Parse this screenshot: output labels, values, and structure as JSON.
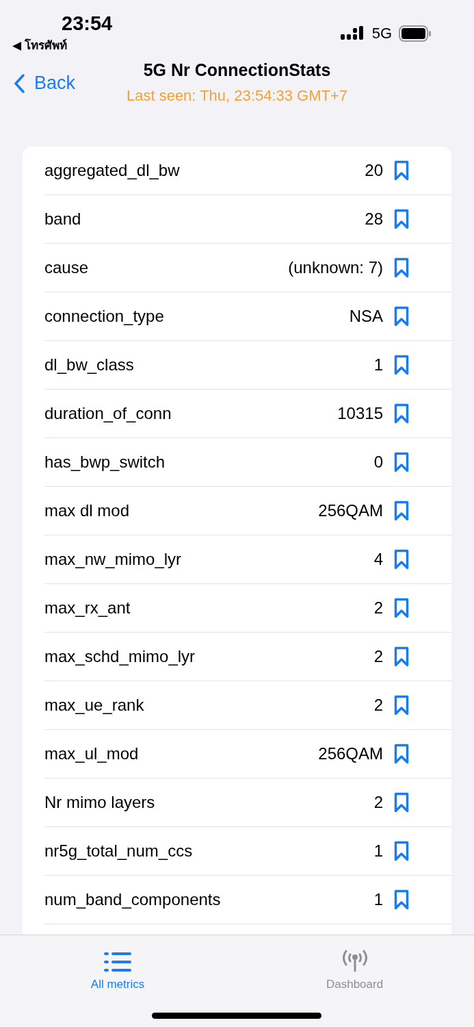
{
  "status_bar": {
    "time": "23:54",
    "back_app": "◀ โทรศัพท์",
    "network": "5G"
  },
  "nav": {
    "back": "Back",
    "title": "5G Nr ConnectionStats",
    "subtitle": "Last seen: Thu, 23:54:33 GMT+7"
  },
  "metrics": [
    {
      "name": "aggregated_dl_bw",
      "value": "20"
    },
    {
      "name": "band",
      "value": "28"
    },
    {
      "name": "cause",
      "value": "(unknown: 7)"
    },
    {
      "name": "connection_type",
      "value": "NSA"
    },
    {
      "name": "dl_bw_class",
      "value": "1"
    },
    {
      "name": "duration_of_conn",
      "value": "10315"
    },
    {
      "name": "has_bwp_switch",
      "value": "0"
    },
    {
      "name": "max dl mod",
      "value": "256QAM"
    },
    {
      "name": "max_nw_mimo_lyr",
      "value": "4"
    },
    {
      "name": "max_rx_ant",
      "value": "2"
    },
    {
      "name": "max_schd_mimo_lyr",
      "value": "2"
    },
    {
      "name": "max_ue_rank",
      "value": "2"
    },
    {
      "name": "max_ul_mod",
      "value": "256QAM"
    },
    {
      "name": "Nr mimo layers",
      "value": "2"
    },
    {
      "name": "nr5g_total_num_ccs",
      "value": "1"
    },
    {
      "name": "num_band_components",
      "value": "1"
    }
  ],
  "tabs": [
    {
      "label": "All metrics",
      "kind": "list",
      "selected": true
    },
    {
      "label": "Dashboard",
      "kind": "antenna",
      "selected": false
    }
  ]
}
